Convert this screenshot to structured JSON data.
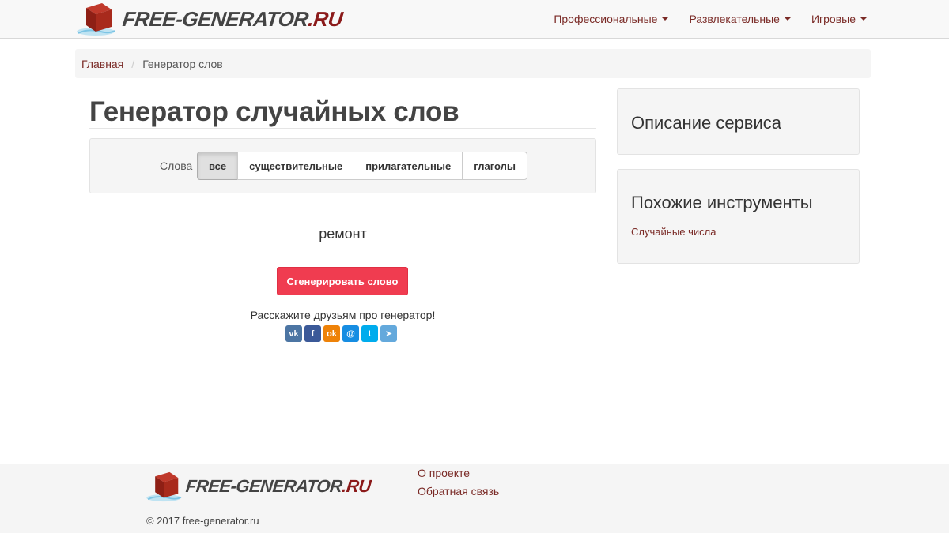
{
  "site": {
    "logo_main": "FREE-GENERATOR",
    "logo_tld": ".RU"
  },
  "nav": {
    "items": [
      {
        "label": "Профессиональные"
      },
      {
        "label": "Развлекательные"
      },
      {
        "label": "Игровые"
      }
    ]
  },
  "breadcrumb": {
    "home": "Главная",
    "current": "Генератор слов"
  },
  "main": {
    "title": "Генератор случайных слов",
    "filter_label": "Слова",
    "filters": [
      {
        "label": "все",
        "active": true
      },
      {
        "label": "существительные",
        "active": false
      },
      {
        "label": "прилагательные",
        "active": false
      },
      {
        "label": "глаголы",
        "active": false
      }
    ],
    "result": "ремонт",
    "generate_button": "Сгенерировать слово",
    "share_text": "Расскажите друзьям про генератор!",
    "social": [
      {
        "icon": "vk-icon",
        "glyph": "vk",
        "color": "#4c75a3"
      },
      {
        "icon": "facebook-icon",
        "glyph": "f",
        "color": "#3b5998"
      },
      {
        "icon": "odnoklassniki-icon",
        "glyph": "ok",
        "color": "#ee8208"
      },
      {
        "icon": "moimir-icon",
        "glyph": "@",
        "color": "#168de2"
      },
      {
        "icon": "twitter-icon",
        "glyph": "t",
        "color": "#00aced"
      },
      {
        "icon": "telegram-icon",
        "glyph": "➤",
        "color": "#64a9dc"
      }
    ]
  },
  "sidebar": {
    "description_title": "Описание сервиса",
    "tools_title": "Похожие инструменты",
    "tools_links": [
      "Случайные числа"
    ]
  },
  "footer": {
    "links": [
      "О проекте",
      "Обратная связь"
    ],
    "copyright": "© 2017 free-generator.ru"
  }
}
